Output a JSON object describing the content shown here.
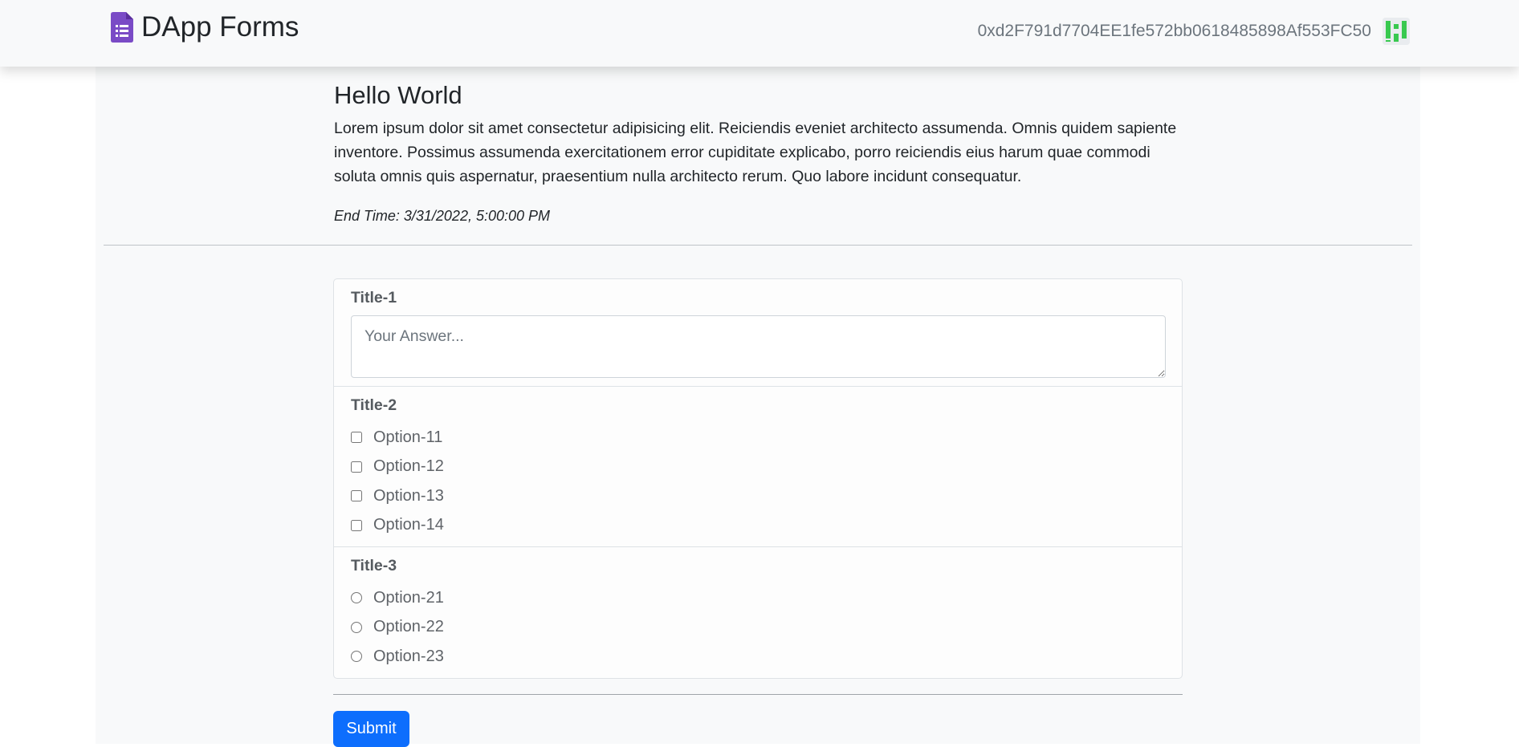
{
  "app": {
    "brand": "DApp Forms",
    "account_address": "0xd2F791d7704EE1fe572bb0618485898Af553FC50",
    "icon": "form-document-icon",
    "avatar": "identicon-avatar"
  },
  "form": {
    "title": "Hello World",
    "description": "Lorem ipsum dolor sit amet consectetur adipisicing elit. Reiciendis eveniet architecto assumenda. Omnis quidem sapiente inventore. Possimus assumenda exercitationem error cupiditate explicabo, porro reiciendis eius harum quae commodi soluta omnis quis aspernatur, praesentium nulla architecto rerum. Quo labore incidunt consequatur.",
    "end_time": "End Time: 3/31/2022, 5:00:00 PM"
  },
  "questions": [
    {
      "title": "Title-1",
      "type": "text",
      "placeholder": "Your Answer...",
      "value": ""
    },
    {
      "title": "Title-2",
      "type": "checkbox",
      "options": [
        "Option-11",
        "Option-12",
        "Option-13",
        "Option-14"
      ]
    },
    {
      "title": "Title-3",
      "type": "radio",
      "options": [
        "Option-21",
        "Option-22",
        "Option-23"
      ]
    }
  ],
  "submit_label": "Submit",
  "colors": {
    "brand_icon": "#7a4bc6",
    "primary": "#0d6efd",
    "avatar_green": "#38c94f"
  }
}
